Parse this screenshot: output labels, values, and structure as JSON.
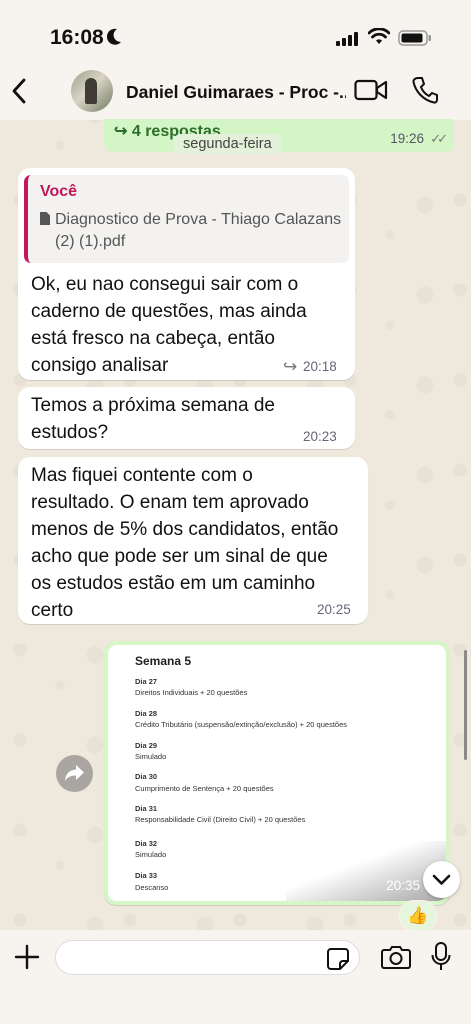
{
  "status_bar": {
    "time": "16:08"
  },
  "header": {
    "contact_name": "Daniel Guimaraes - Proc -..."
  },
  "reply_banner": {
    "text": "↪ 4 respostas",
    "time": "19:26",
    "ticks": "✓✓"
  },
  "date_chip": {
    "label": "segunda-feira"
  },
  "messages": [
    {
      "quote_author": "Você",
      "quote_file": "Diagnostico de Prova - Thiago Calazans (2) (1).pdf",
      "lines": [
        "Ok, eu nao consegui sair com o",
        "caderno de questões, mas ainda",
        "está fresco na cabeça, então",
        "consigo analisar"
      ],
      "forward_mark": "↪",
      "time": "20:18"
    },
    {
      "lines": [
        "Temos a próxima semana de",
        "estudos?"
      ],
      "time": "20:23"
    },
    {
      "lines": [
        "Mas fiquei contente com o",
        "resultado. O enam tem aprovado",
        "menos de 5% dos candidatos, então",
        "acho que pode ser um sinal de que",
        "os estudos estão em um caminho",
        "certo"
      ],
      "time": "20:25"
    }
  ],
  "image_message": {
    "title": "Semana 5",
    "days": [
      {
        "day": "Dia 27",
        "task": "Direitos Individuais + 20 questões"
      },
      {
        "day": "Dia 28",
        "task": "Crédito Tributário (suspensão/extinção/exclusão) + 20 questões"
      },
      {
        "day": "Dia 29",
        "task": "Simulado"
      },
      {
        "day": "Dia 30",
        "task": "Cumprimento de Sentença + 20 questões"
      },
      {
        "day": "Dia 31",
        "task": "Responsabilidade Civil (Direito Civil) + 20 questões"
      },
      {
        "day": "Dia 32",
        "task": "Simulado"
      },
      {
        "day": "Dia 33",
        "task": "Descanso"
      }
    ],
    "time": "20:35",
    "reaction": "👍"
  },
  "colors": {
    "outgoing": "#d4f5c6",
    "quote_accent": "#c2185b",
    "link_green": "#2c6e2a"
  }
}
